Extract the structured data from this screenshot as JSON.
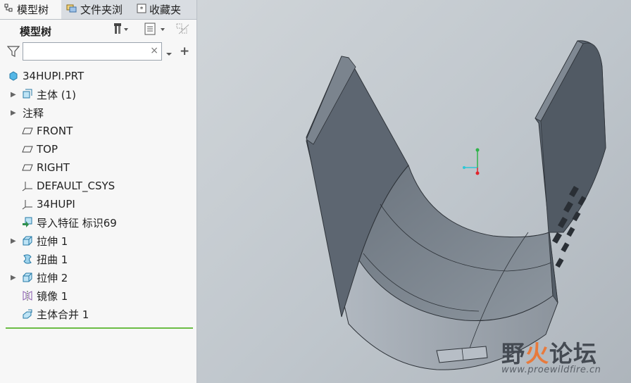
{
  "tabs": [
    {
      "label": "模型树",
      "icon": "model-tree-icon"
    },
    {
      "label": "文件夹浏",
      "icon": "folder-browser-icon"
    },
    {
      "label": "收藏夹",
      "icon": "favorites-icon"
    }
  ],
  "panel": {
    "title": "模型树",
    "filter": {
      "value": "",
      "placeholder": ""
    }
  },
  "tree": [
    {
      "label": "34HUPI.PRT",
      "icon": "part-icon",
      "expandable": false,
      "indent": 0
    },
    {
      "label": "主体 (1)",
      "icon": "body-icon",
      "expandable": true,
      "indent": 1
    },
    {
      "label": "注释",
      "icon": "",
      "expandable": true,
      "indent": 0
    },
    {
      "label": "FRONT",
      "icon": "datum-plane-icon",
      "expandable": false,
      "indent": 1
    },
    {
      "label": "TOP",
      "icon": "datum-plane-icon",
      "expandable": false,
      "indent": 1
    },
    {
      "label": "RIGHT",
      "icon": "datum-plane-icon",
      "expandable": false,
      "indent": 1
    },
    {
      "label": "DEFAULT_CSYS",
      "icon": "csys-icon",
      "expandable": false,
      "indent": 1
    },
    {
      "label": "34HUPI",
      "icon": "csys-icon",
      "expandable": false,
      "indent": 1
    },
    {
      "label": "导入特征 标识69",
      "icon": "import-feature-icon",
      "expandable": false,
      "indent": 1
    },
    {
      "label": "拉伸 1",
      "icon": "extrude-icon",
      "expandable": true,
      "indent": 1
    },
    {
      "label": "扭曲 1",
      "icon": "warp-icon",
      "expandable": false,
      "indent": 1
    },
    {
      "label": "拉伸 2",
      "icon": "extrude-icon",
      "expandable": true,
      "indent": 1
    },
    {
      "label": "镜像 1",
      "icon": "mirror-icon",
      "expandable": false,
      "indent": 1
    },
    {
      "label": "主体合并 1",
      "icon": "body-merge-icon",
      "expandable": false,
      "indent": 1
    }
  ],
  "watermark": {
    "logo_part1": "野",
    "logo_part2": "火",
    "logo_part3": "论坛",
    "url": "www.proewildfire.cn"
  },
  "colors": {
    "panel_bg": "#f7f7f7",
    "viewport_bg": "#c3c9ce",
    "model_face": "#5f6873",
    "accent_line": "#6cbd45"
  }
}
